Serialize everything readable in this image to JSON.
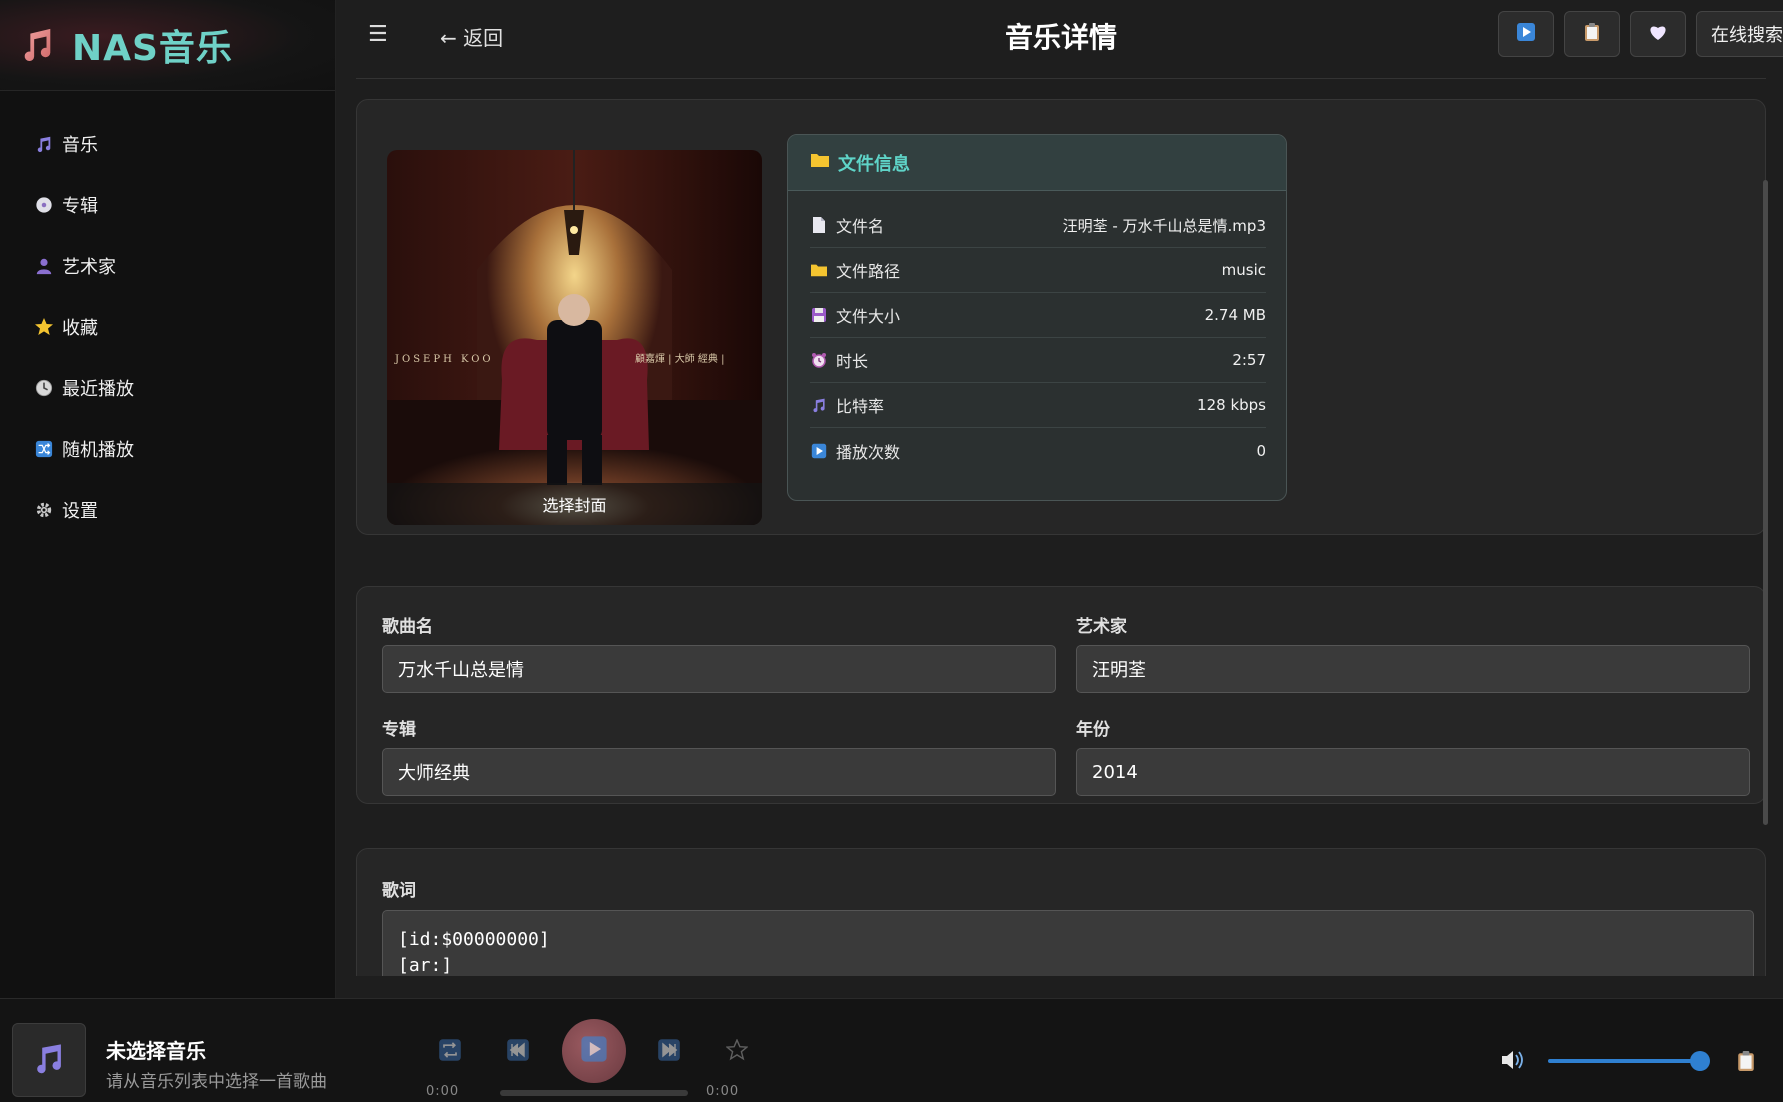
{
  "brand": {
    "title": "NAS音乐"
  },
  "sidebar": {
    "items": [
      {
        "label": "音乐",
        "icon": "music-note-icon"
      },
      {
        "label": "专辑",
        "icon": "disc-icon"
      },
      {
        "label": "艺术家",
        "icon": "person-icon"
      },
      {
        "label": "收藏",
        "icon": "star-icon"
      },
      {
        "label": "最近播放",
        "icon": "clock-icon"
      },
      {
        "label": "随机播放",
        "icon": "shuffle-icon"
      },
      {
        "label": "设置",
        "icon": "gear-icon"
      }
    ]
  },
  "topbar": {
    "back_label": "← 返回",
    "title": "音乐详情",
    "search_label": "在线搜索"
  },
  "cover": {
    "label": "选择封面",
    "album_text_left": "JOSEPH KOO",
    "album_text_right": "顧嘉煇 | 大師 經典 |"
  },
  "file_info": {
    "title": "文件信息",
    "rows": [
      {
        "key": "文件名",
        "value": "汪明荃 - 万水千山总是情.mp3",
        "icon": "document-icon"
      },
      {
        "key": "文件路径",
        "value": "music",
        "icon": "folder-icon"
      },
      {
        "key": "文件大小",
        "value": "2.74 MB",
        "icon": "floppy-icon"
      },
      {
        "key": "时长",
        "value": "2:57",
        "icon": "alarm-clock-icon"
      },
      {
        "key": "比特率",
        "value": "128 kbps",
        "icon": "music-note-icon"
      },
      {
        "key": "播放次数",
        "value": "0",
        "icon": "play-icon"
      }
    ]
  },
  "form": {
    "title_label": "歌曲名",
    "title_value": "万水千山总是情",
    "artist_label": "艺术家",
    "artist_value": "汪明荃",
    "album_label": "专辑",
    "album_value": "大师经典",
    "year_label": "年份",
    "year_value": "2014"
  },
  "lyrics": {
    "label": "歌词",
    "line1": "[id:$00000000]",
    "line2": "[ar:]"
  },
  "player": {
    "title": "未选择音乐",
    "subtitle": "请从音乐列表中选择一首歌曲",
    "time_current": "0:00",
    "time_total": "0:00",
    "volume_percent": 100
  },
  "colors": {
    "accent": "#5fd4c8",
    "volume": "#2f80d1",
    "background": "#1e1e1e",
    "sidebar": "#111111"
  }
}
